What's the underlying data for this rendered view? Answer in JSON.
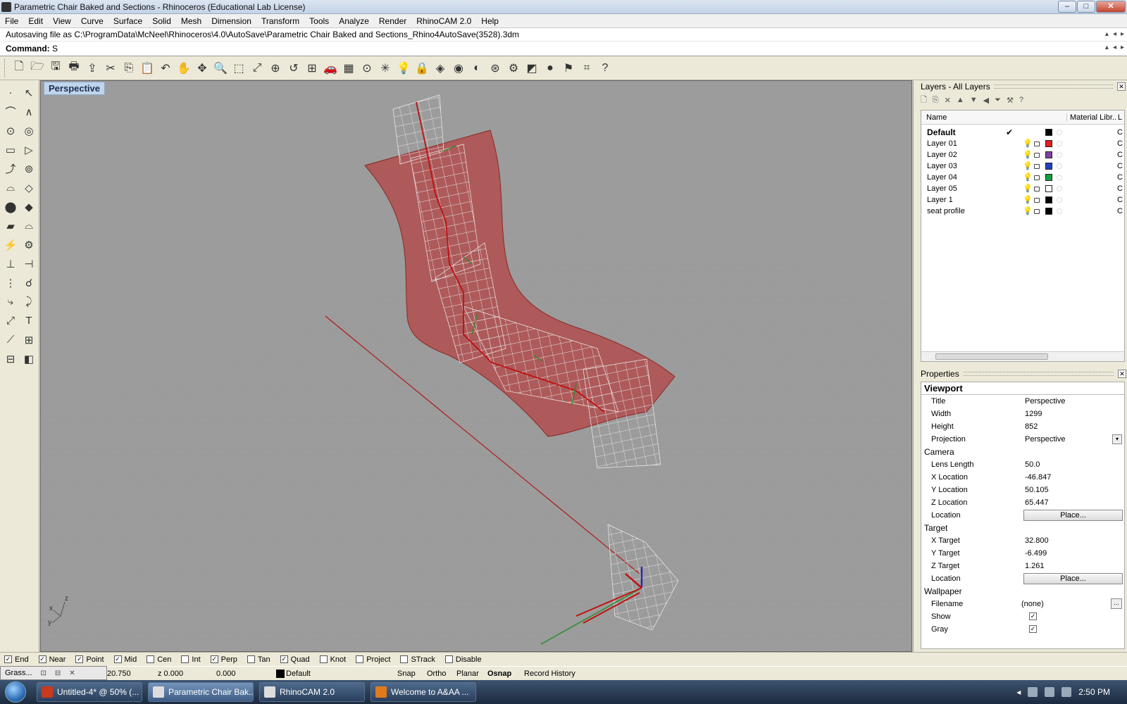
{
  "window": {
    "title": "Parametric Chair Baked and Sections - Rhinoceros (Educational Lab License)",
    "controls": {
      "minimize": "–",
      "maximize": "□",
      "close": "✕"
    }
  },
  "menu": [
    "File",
    "Edit",
    "View",
    "Curve",
    "Surface",
    "Solid",
    "Mesh",
    "Dimension",
    "Transform",
    "Tools",
    "Analyze",
    "Render",
    "RhinoCAM 2.0",
    "Help"
  ],
  "command": {
    "history": "Autosaving file as C:\\ProgramData\\McNeel\\Rhinoceros\\4.0\\AutoSave\\Parametric Chair Baked and Sections_Rhino4AutoSave(3528).3dm",
    "prompt_label": "Command:",
    "prompt_value": "S"
  },
  "toolbar_icons": [
    "new-icon",
    "open-icon",
    "save-icon",
    "print-icon",
    "export-icon",
    "cut-icon",
    "copy-icon",
    "paste-icon",
    "undo-icon",
    "pan-icon",
    "rotate-view-icon",
    "zoom-icon",
    "zoom-window-icon",
    "zoom-extents-icon",
    "zoom-selected-icon",
    "undo-view-icon",
    "four-viewports-icon",
    "car-icon",
    "shaded-icon",
    "osnap-icon",
    "point-icon",
    "light-icon",
    "lock-icon",
    "layer-icon",
    "color-icon",
    "render-icon",
    "mesh-icon",
    "gear-icon",
    "object-icon",
    "sphere-icon",
    "arrow-flag-icon",
    "grid-icon",
    "help-icon"
  ],
  "toolbar_glyphs": [
    "🗋",
    "🗁",
    "🖫",
    "🖶",
    "⇪",
    "✂",
    "⎘",
    "📋",
    "↶",
    "✋",
    "✥",
    "🔍",
    "⬚",
    "⤢",
    "⊕",
    "↺",
    "⊞",
    "🚗",
    "▦",
    "⊙",
    "✳",
    "💡",
    "🔒",
    "◈",
    "◉",
    "◐",
    "⊛",
    "⚙",
    "◩",
    "●",
    "⚑",
    "⌗",
    "?"
  ],
  "left_tools": [
    "·",
    "↖",
    "⌒",
    "∧",
    "⊙",
    "◎",
    "▭",
    "▷",
    "⤴",
    "⊚",
    "⌓",
    "◇",
    "⬤",
    "◆",
    "▰",
    "⌓",
    "⚡",
    "⚙",
    "⊥",
    "⊣",
    "⋮",
    "☌",
    "⤷",
    "⤸",
    "⤢",
    "T",
    "⟋",
    "⊞",
    "⊟",
    "◧"
  ],
  "viewport": {
    "title": "Perspective",
    "axes": {
      "x": "x",
      "y": "y",
      "z": "z"
    }
  },
  "layers_panel": {
    "title": "Layers - All Layers",
    "tools": [
      "🗋",
      "⎘",
      "✕",
      "▲",
      "▼",
      "◀",
      "⏷",
      "⚒",
      "?"
    ],
    "columns": {
      "name": "Name",
      "material": "Material Libr...",
      "tail": "L"
    },
    "rows": [
      {
        "name": "Default",
        "current": "✔",
        "color": "#000000",
        "tail": "C"
      },
      {
        "name": "Layer 01",
        "color": "#e02020",
        "tail": "C"
      },
      {
        "name": "Layer 02",
        "color": "#8040a0",
        "tail": "C"
      },
      {
        "name": "Layer 03",
        "color": "#2040c0",
        "tail": "C"
      },
      {
        "name": "Layer 04",
        "color": "#10a040",
        "tail": "C"
      },
      {
        "name": "Layer 05",
        "color": "#ffffff",
        "tail": "C"
      },
      {
        "name": "Layer 1",
        "color": "#000000",
        "tail": "C"
      },
      {
        "name": "seat profile",
        "color": "#000000",
        "tail": "C"
      }
    ],
    "bulb": "💡"
  },
  "properties": {
    "title": "Properties",
    "section": "Viewport",
    "title_label": "Title",
    "title_value": "Perspective",
    "width_label": "Width",
    "width_value": "1299",
    "height_label": "Height",
    "height_value": "852",
    "projection_label": "Projection",
    "projection_value": "Perspective",
    "camera": "Camera",
    "lens_label": "Lens Length",
    "lens_value": "50.0",
    "xloc_label": "X Location",
    "xloc_value": "-46.847",
    "yloc_label": "Y Location",
    "yloc_value": "50.105",
    "zloc_label": "Z Location",
    "zloc_value": "65.447",
    "loc_label": "Location",
    "place_label": "Place...",
    "target": "Target",
    "xt_label": "X Target",
    "xt_value": "32.800",
    "yt_label": "Y Target",
    "yt_value": "-6.499",
    "zt_label": "Z Target",
    "zt_value": "1.261",
    "wallpaper": "Wallpaper",
    "filename_label": "Filename",
    "filename_value": "(none)",
    "show_label": "Show",
    "gray_label": "Gray",
    "check": "✓",
    "ellipsis": "...",
    "dropdown": "▾"
  },
  "osnaps": [
    {
      "label": "End",
      "checked": true
    },
    {
      "label": "Near",
      "checked": true
    },
    {
      "label": "Point",
      "checked": true
    },
    {
      "label": "Mid",
      "checked": true
    },
    {
      "label": "Cen",
      "checked": false
    },
    {
      "label": "Int",
      "checked": false
    },
    {
      "label": "Perp",
      "checked": true
    },
    {
      "label": "Tan",
      "checked": false
    },
    {
      "label": "Quad",
      "checked": true
    },
    {
      "label": "Knot",
      "checked": false
    },
    {
      "label": "Project",
      "checked": false
    },
    {
      "label": "STrack",
      "checked": false
    },
    {
      "label": "Disable",
      "checked": false
    }
  ],
  "status": {
    "x": "20.750",
    "z": "z 0.000",
    "extra": "0.000",
    "layer": "Default",
    "snap": "Snap",
    "ortho": "Ortho",
    "planar": "Planar",
    "osnap": "Osnap",
    "history": "Record History"
  },
  "grasshopper": {
    "label": "Grass...",
    "restore": "⊡",
    "max": "⊟",
    "close": "✕"
  },
  "taskbar": {
    "tasks": [
      {
        "label": "Untitled-4* @ 50% (...",
        "icon_color": "#c83a1c"
      },
      {
        "label": "Parametric Chair Bak...",
        "icon_color": "#ddd",
        "active": true
      },
      {
        "label": "RhinoCAM 2.0",
        "icon_color": "#ddd"
      },
      {
        "label": "Welcome to A&AA ...",
        "icon_color": "#e07b1c"
      }
    ],
    "clock": "2:50 PM",
    "tray_arrow": "◂"
  }
}
